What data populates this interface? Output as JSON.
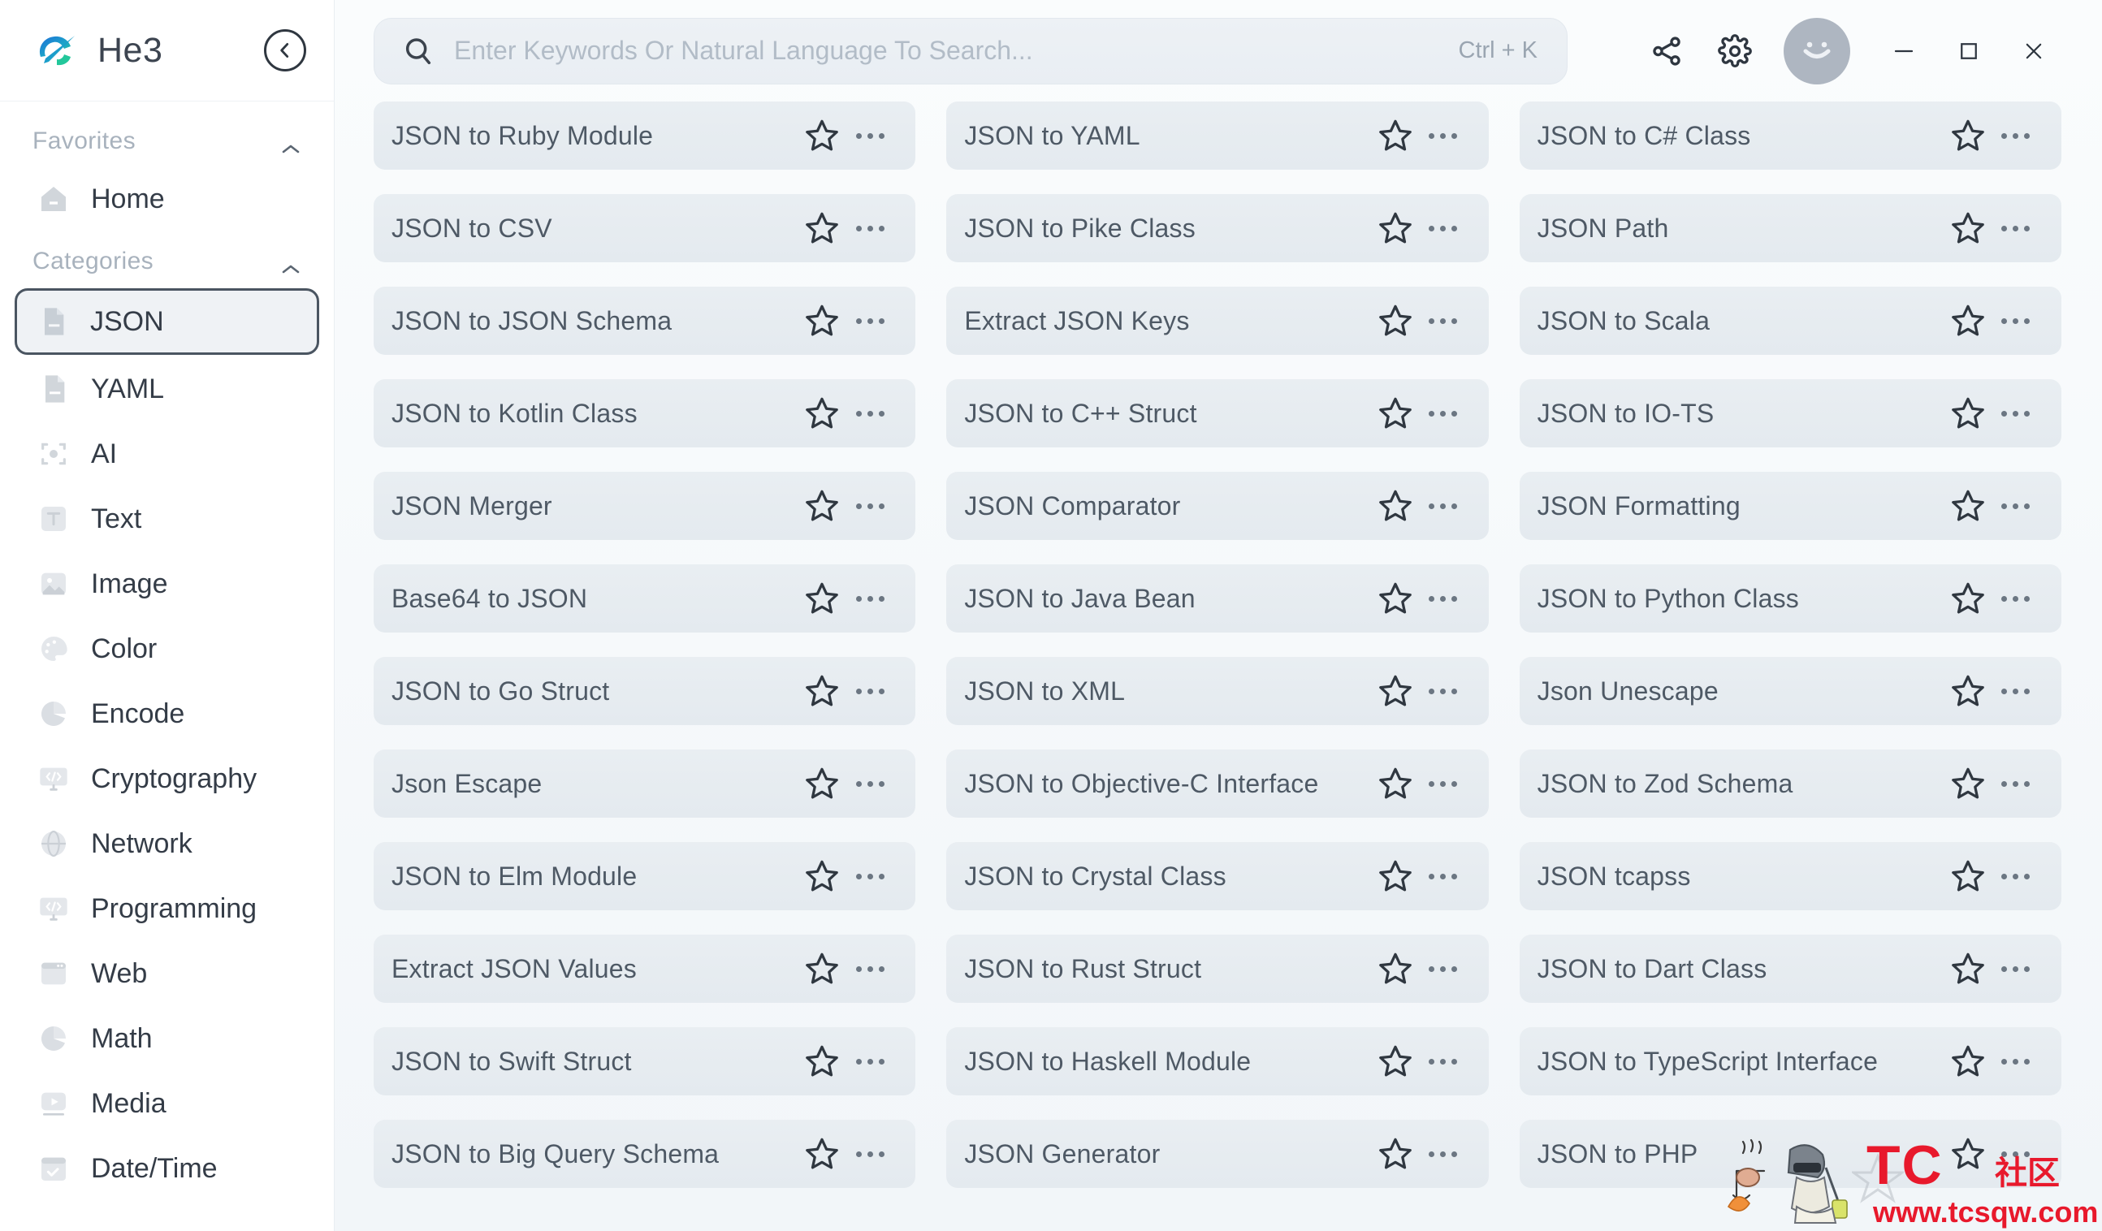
{
  "app": {
    "brand_name": "He3",
    "logo_icon": "he3-logo-icon",
    "collapse_icon": "chevron-left-circle-icon"
  },
  "search": {
    "placeholder": "Enter Keywords Or Natural Language To Search...",
    "value": "",
    "shortcut": "Ctrl + K",
    "icon": "search-icon"
  },
  "titlebar": {
    "share_icon": "share-icon",
    "settings_icon": "gear-icon",
    "avatar_icon": "user-avatar-smiley-icon",
    "minimize_label": "minimize-icon",
    "maximize_label": "maximize-icon",
    "close_label": "close-icon"
  },
  "sidebar": {
    "groups": [
      {
        "label": "Favorites",
        "collapse_icon": "chevron-up-icon",
        "items": [
          {
            "label": "Home",
            "icon": "home-icon",
            "selected": false
          }
        ]
      },
      {
        "label": "Categories",
        "collapse_icon": "chevron-up-icon",
        "items": [
          {
            "label": "JSON",
            "icon": "file-json-icon",
            "selected": true
          },
          {
            "label": "YAML",
            "icon": "file-yaml-icon",
            "selected": false
          },
          {
            "label": "AI",
            "icon": "ai-sparkle-icon",
            "selected": false
          },
          {
            "label": "Text",
            "icon": "text-icon",
            "selected": false
          },
          {
            "label": "Image",
            "icon": "image-icon",
            "selected": false
          },
          {
            "label": "Color",
            "icon": "color-palette-icon",
            "selected": false
          },
          {
            "label": "Encode",
            "icon": "encode-pie-icon",
            "selected": false
          },
          {
            "label": "Cryptography",
            "icon": "cryptography-monitor-icon",
            "selected": false
          },
          {
            "label": "Network",
            "icon": "network-globe-icon",
            "selected": false
          },
          {
            "label": "Programming",
            "icon": "programming-monitor-icon",
            "selected": false
          },
          {
            "label": "Web",
            "icon": "web-browser-icon",
            "selected": false
          },
          {
            "label": "Math",
            "icon": "math-pie-icon",
            "selected": false
          },
          {
            "label": "Media",
            "icon": "media-play-icon",
            "selected": false
          },
          {
            "label": "Date/Time",
            "icon": "calendar-icon",
            "selected": false
          }
        ]
      }
    ]
  },
  "tools": {
    "favorite_icon": "star-outline-icon",
    "more_icon": "ellipsis-icon",
    "cards": [
      {
        "title": "JSON to Ruby Module"
      },
      {
        "title": "JSON to YAML"
      },
      {
        "title": "JSON to C# Class"
      },
      {
        "title": "JSON to CSV"
      },
      {
        "title": "JSON to Pike Class"
      },
      {
        "title": "JSON Path"
      },
      {
        "title": "JSON to JSON Schema"
      },
      {
        "title": "Extract JSON Keys"
      },
      {
        "title": "JSON to Scala"
      },
      {
        "title": "JSON to Kotlin Class"
      },
      {
        "title": "JSON to C++ Struct"
      },
      {
        "title": "JSON to IO-TS"
      },
      {
        "title": "JSON Merger"
      },
      {
        "title": "JSON Comparator"
      },
      {
        "title": "JSON Formatting"
      },
      {
        "title": "Base64 to JSON"
      },
      {
        "title": "JSON to Java Bean"
      },
      {
        "title": "JSON to Python Class"
      },
      {
        "title": "JSON to Go Struct"
      },
      {
        "title": "JSON to XML"
      },
      {
        "title": "Json Unescape"
      },
      {
        "title": "Json Escape"
      },
      {
        "title": "JSON to Objective-C Interface"
      },
      {
        "title": "JSON to Zod Schema"
      },
      {
        "title": "JSON to Elm Module"
      },
      {
        "title": "JSON to Crystal Class"
      },
      {
        "title": "JSON tcapss"
      },
      {
        "title": "Extract JSON Values"
      },
      {
        "title": "JSON to Rust Struct"
      },
      {
        "title": "JSON to Dart Class"
      },
      {
        "title": "JSON to Swift Struct"
      },
      {
        "title": "JSON to Haskell Module"
      },
      {
        "title": "JSON to TypeScript Interface"
      },
      {
        "title": "JSON to Big Query Schema"
      },
      {
        "title": "JSON Generator"
      },
      {
        "title": "JSON to PHP"
      }
    ]
  },
  "watermark": {
    "tc": "TC",
    "cn": "社区",
    "url": "www.tcsqw.com",
    "color": "#e8192c"
  }
}
